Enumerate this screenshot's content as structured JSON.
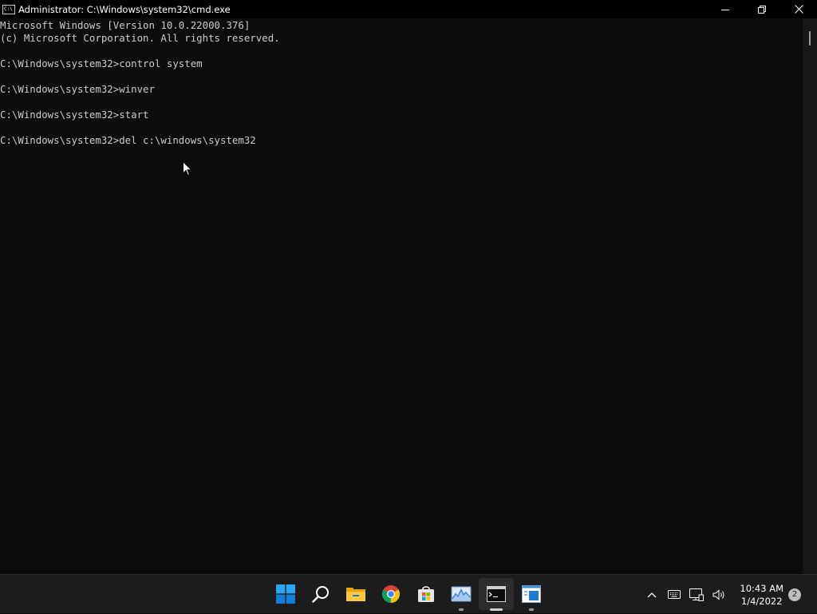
{
  "window": {
    "title": "Administrator: C:\\Windows\\system32\\cmd.exe",
    "icon_text": "C:\\"
  },
  "console": {
    "lines": [
      "Microsoft Windows [Version 10.0.22000.376]",
      "(c) Microsoft Corporation. All rights reserved.",
      "",
      "C:\\Windows\\system32>control system",
      "",
      "C:\\Windows\\system32>winver",
      "",
      "C:\\Windows\\system32>start",
      "",
      "C:\\Windows\\system32>del c:\\windows\\system32"
    ]
  },
  "taskbar": {
    "items": [
      {
        "name": "start-icon",
        "running": false
      },
      {
        "name": "search-icon",
        "running": false
      },
      {
        "name": "file-explorer-icon",
        "running": false
      },
      {
        "name": "chrome-icon",
        "running": false
      },
      {
        "name": "microsoft-store-icon",
        "running": false
      },
      {
        "name": "performance-monitor-icon",
        "running": true
      },
      {
        "name": "command-prompt-icon",
        "running": true,
        "active": true
      },
      {
        "name": "system-information-icon",
        "running": true
      }
    ],
    "clock": {
      "time": "10:43 AM",
      "date": "1/4/2022"
    },
    "notification_count": "2"
  },
  "colors": {
    "console_bg": "#0c0c0c",
    "console_fg": "#cccccc",
    "taskbar_bg": "#1c1c1c",
    "accent_blue": "#0078d4"
  }
}
